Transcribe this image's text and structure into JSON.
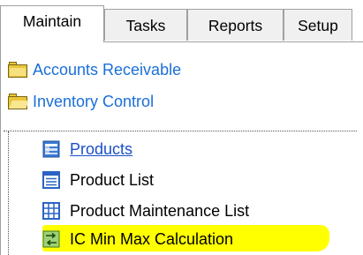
{
  "tabs": [
    {
      "label": "Maintain",
      "active": true
    },
    {
      "label": "Tasks",
      "active": false
    },
    {
      "label": "Reports",
      "active": false
    },
    {
      "label": "Setup",
      "active": false
    }
  ],
  "tree": {
    "folders": [
      {
        "label": "Accounts Receivable",
        "icon": "folder-icon",
        "state": "closed"
      },
      {
        "label": "Inventory Control",
        "icon": "folder-open-icon",
        "state": "open"
      }
    ],
    "items": [
      {
        "label": "Products",
        "icon": "form-icon",
        "selected": true
      },
      {
        "label": "Product List",
        "icon": "list-icon"
      },
      {
        "label": "Product Maintenance List",
        "icon": "grid-icon"
      },
      {
        "label": "IC Min Max Calculation",
        "icon": "calculation-icon",
        "highlighted": true
      }
    ]
  },
  "colors": {
    "link": "#1a6fd9",
    "highlight": "#ffff00",
    "folder": "#e9c63a"
  }
}
